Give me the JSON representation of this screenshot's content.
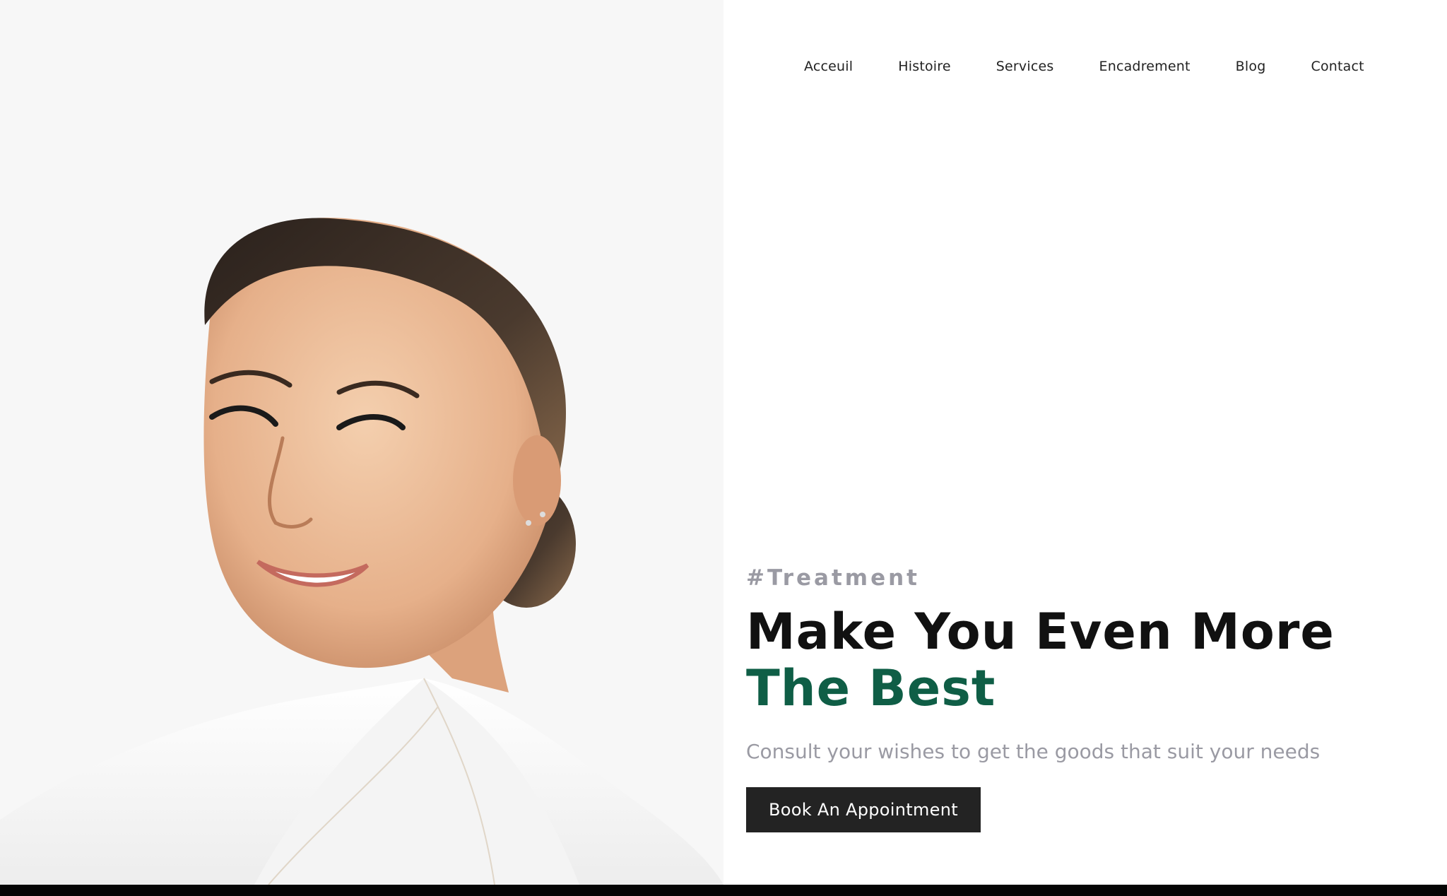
{
  "nav": {
    "items": [
      {
        "label": "Acceuil"
      },
      {
        "label": "Histoire"
      },
      {
        "label": "Services"
      },
      {
        "label": "Encadrement"
      },
      {
        "label": "Blog"
      },
      {
        "label": "Contact"
      }
    ]
  },
  "hero": {
    "tag": "#Treatment",
    "title_line1": "Make You Even More",
    "title_line2": "The Best",
    "subtitle": "Consult your wishes to get the goods that suit your needs",
    "cta_label": "Book An Appointment",
    "image_subject": "smiling-woman-portrait"
  },
  "colors": {
    "accent": "#0f5e46",
    "muted_text": "#9a9aa3",
    "button_bg": "#232323",
    "photo_bg": "#f7f7f7"
  }
}
